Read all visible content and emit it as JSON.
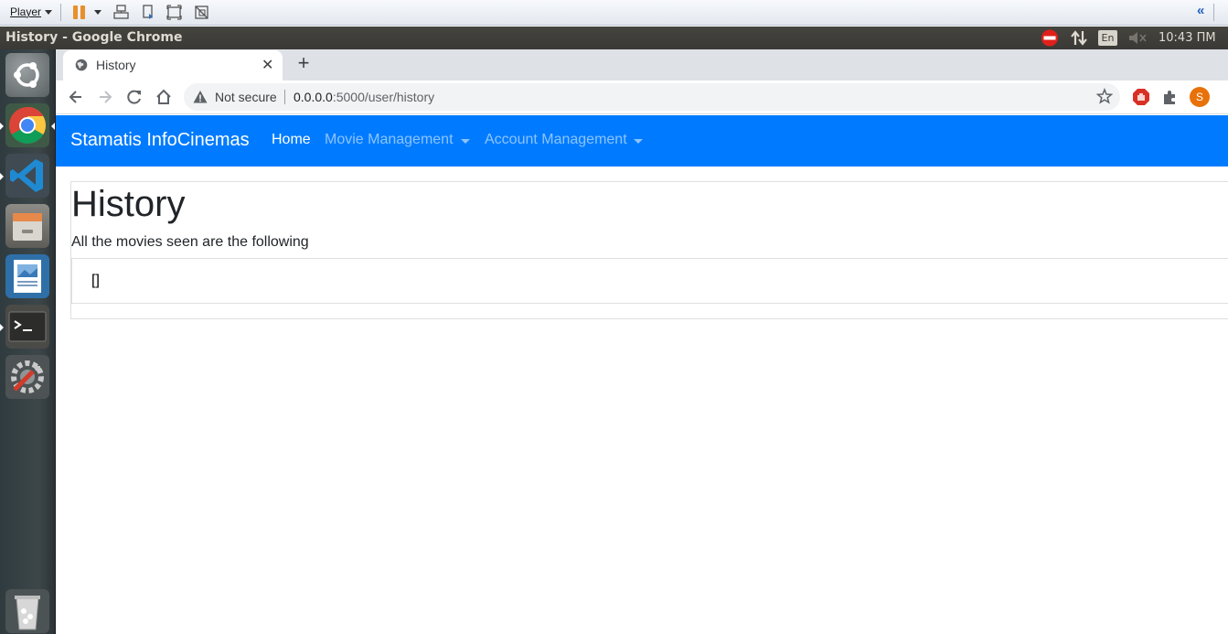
{
  "vmware": {
    "menu_label": "Player"
  },
  "top_panel": {
    "window_title": "History - Google Chrome",
    "keyboard_layout": "En",
    "clock": "10:43 ΠΜ"
  },
  "launcher": {
    "apps": [
      "ubuntu-dash-icon",
      "chrome-icon",
      "vscode-icon",
      "files-icon",
      "image-viewer-icon",
      "terminal-icon",
      "settings-icon",
      "trash-icon"
    ]
  },
  "browser": {
    "tab": {
      "title": "History",
      "close": "✕"
    },
    "new_tab": "+",
    "address": {
      "security": "Not secure",
      "host": "0.0.0.0",
      "path": ":5000/user/history"
    },
    "profile_initial": "S"
  },
  "navbar": {
    "brand": "Stamatis InfoCinemas",
    "links": {
      "home": "Home",
      "movie_management": "Movie Management",
      "account_management": "Account Management"
    }
  },
  "main": {
    "heading": "History",
    "description": "All the movies seen are the following",
    "movies_value": "[]"
  },
  "colors": {
    "navbar": "#007bff",
    "panel": "#3c3b37",
    "launcher": "#353f42"
  }
}
